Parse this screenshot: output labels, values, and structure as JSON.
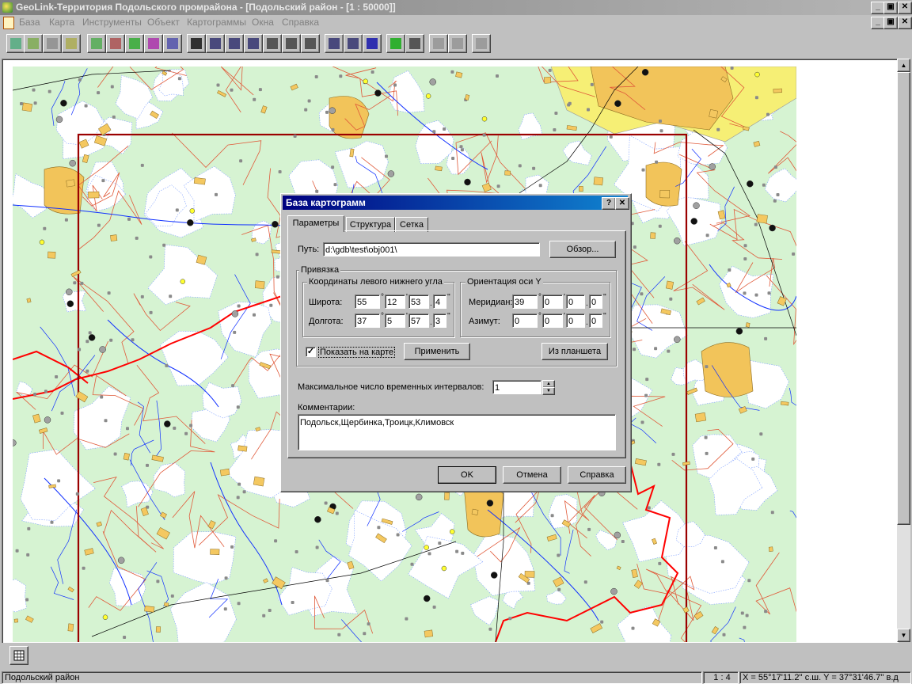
{
  "window": {
    "title": "GeoLink-Территория Подольского промрайона - [Подольский район - [1 : 50000]]",
    "minimize": "_",
    "maximize": "▣",
    "close": "✕"
  },
  "menu": [
    "База",
    "Карта",
    "Инструменты",
    "Объект",
    "Картограммы",
    "Окна",
    "Справка"
  ],
  "toolbar": {
    "icons": [
      "globe-icon",
      "layers-icon",
      "layer-copy-icon",
      "select-area-icon",
      "chart-icon",
      "edit-chart-icon",
      "save-icon",
      "bar-chart-icon",
      "graph-icon",
      "pointer-icon",
      "zoom-out-icon",
      "zoom-in-icon",
      "zoom-window-icon",
      "table-icon",
      "grid-icon",
      "move-icon",
      "legend-icon",
      "find-icon",
      "info-icon",
      "add-layer-icon",
      "list-icon",
      "print-icon",
      "print-setup-icon",
      "help-icon"
    ]
  },
  "dialog": {
    "title": "База картограмм",
    "help_btn": "?",
    "close_btn": "✕",
    "tabs": [
      "Параметры",
      "Структура",
      "Сетка"
    ],
    "path_label": "Путь:",
    "path_value": "d:\\gdb\\test\\obj001\\",
    "browse_btn": "Обзор...",
    "binding_group": "Привязка",
    "coords_group": "Координаты левого нижнего угла",
    "lat_label": "Широта:",
    "lat": [
      "55",
      "12",
      "53",
      "4"
    ],
    "lon_label": "Долгота:",
    "lon": [
      "37",
      "5",
      "57",
      "3"
    ],
    "orient_group": "Ориентация оси Y",
    "meridian_label": "Меридиан:",
    "meridian": [
      "39",
      "0",
      "0",
      "0"
    ],
    "azimuth_label": "Азимут:",
    "azimuth": [
      "0",
      "0",
      "0",
      "0"
    ],
    "units": [
      "°",
      "'",
      "''",
      "°",
      "'",
      "''"
    ],
    "show_on_map": "Показать на карте",
    "show_checked": "✓",
    "apply_btn": "Применить",
    "from_tablet_btn": "Из планшета",
    "max_intervals_label": "Максимальное число временных интервалов:",
    "max_intervals": "1",
    "comments_label": "Комментарии:",
    "comments": "Подольск,Щербинка,Троицк,Климовск",
    "ok_btn": "OK",
    "cancel_btn": "Отмена",
    "help_button": "Справка"
  },
  "status": {
    "layer": "Подольский район",
    "scale": "1 : 4",
    "coords": "X = 55°17'11.2'' с.ш.  Y = 37°31'46.7'' в.д"
  },
  "colors": {
    "map_bg": "#d4f5d4",
    "urban": "#f5c860",
    "yellow_zone": "#ffff70",
    "road": "#e05030",
    "river": "#0030ff",
    "boundary": "#9b0000",
    "admin_border": "#ff0000"
  }
}
